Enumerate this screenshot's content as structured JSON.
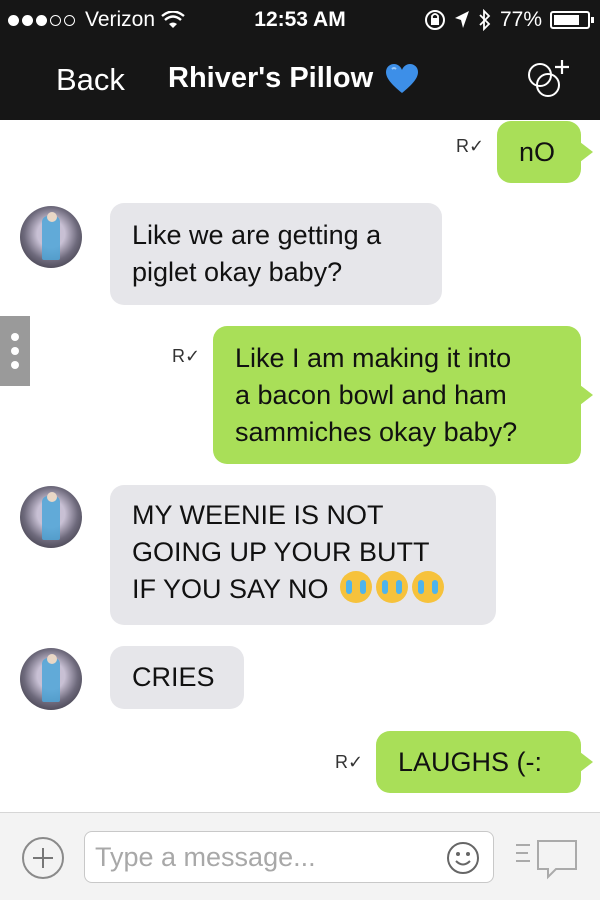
{
  "status_bar": {
    "carrier": "Verizon",
    "time": "12:53 AM",
    "battery": "77%",
    "battery_level": 0.77
  },
  "header": {
    "back_label": "Back",
    "title": "Rhiver's Pillow",
    "title_emoji": "blue-heart-icon",
    "action_icon": "group-add-icon"
  },
  "read_mark": "R✓",
  "messages": [
    {
      "side": "out",
      "text": "nO",
      "read": "R✓"
    },
    {
      "side": "in",
      "lines": [
        "Like we are getting a",
        "piglet okay baby?"
      ]
    },
    {
      "side": "out",
      "lines": [
        "Like I am making it into",
        "a bacon bowl and ham",
        "sammiches okay baby?"
      ],
      "read": "R✓"
    },
    {
      "side": "in",
      "lines": [
        "MY WEENIE IS NOT",
        "GOING UP YOUR BUTT",
        "IF YOU SAY NO"
      ],
      "emojis": [
        "crying-face-icon",
        "crying-face-icon",
        "crying-face-icon"
      ]
    },
    {
      "side": "in",
      "text": "CRIES"
    },
    {
      "side": "out",
      "text": "LAUGHS (-:",
      "read": "R✓"
    }
  ],
  "input": {
    "placeholder": "Type a message...",
    "value": ""
  },
  "colors": {
    "bar": "#161616",
    "incoming_bubble": "#e6e6ea",
    "outgoing_bubble": "#a9df58",
    "heart": "#3d8fe8"
  }
}
